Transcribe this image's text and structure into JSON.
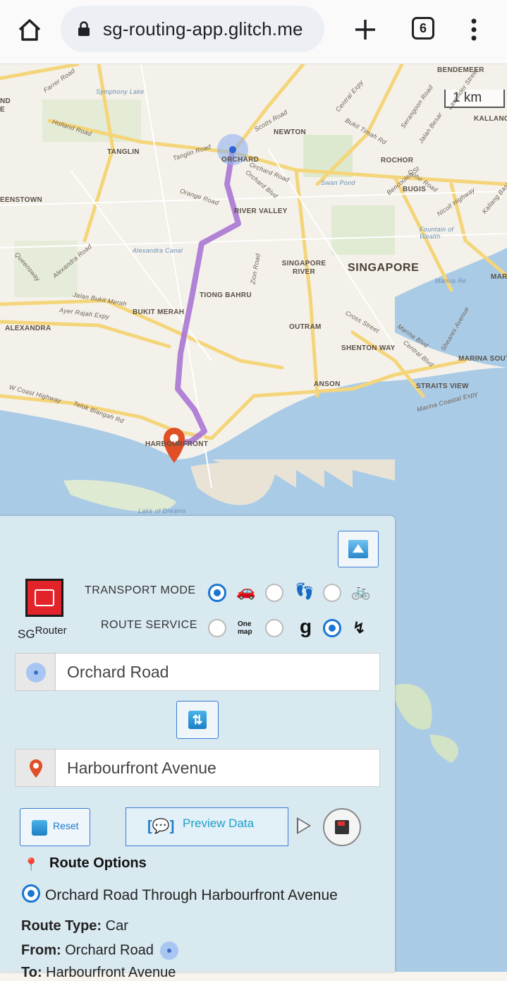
{
  "browser": {
    "url": "sg-routing-app.glitch.me",
    "tab_count": "6",
    "icons": [
      "home-icon",
      "lock-icon",
      "plus-icon",
      "tabs-icon",
      "more-vert-icon"
    ]
  },
  "map": {
    "scale_label": "1 km",
    "labels": {
      "bendemeer": "BENDEMEER",
      "kallang": "KALLANG",
      "newton": "NEWTON",
      "tanglin": "TANGLIN",
      "orchard": "ORCHARD",
      "rochor": "ROCHOR",
      "bugis": "BUGIS",
      "queenstown": "EENSTOWN",
      "river_valley": "RIVER VALLEY",
      "singapore_river": "SINGAPORE RIVER",
      "singapore": "SINGAPORE",
      "tiong_bahru": "TIONG BAHRU",
      "bukit_merah": "BUKIT MERAH",
      "alexandra": "ALEXANDRA",
      "outram": "OUTRAM",
      "shenton_way": "SHENTON WAY",
      "marina_south": "MARINA SOUT",
      "anson": "ANSON",
      "straits_view": "STRAITS VIEW",
      "harbourfront": "HARBOURFRONT",
      "mar": "MAR",
      "nd": "ND",
      "e": "E"
    },
    "road_labels": {
      "holland_road": "Holland Road",
      "farrer_road": "Farrer Road",
      "tanglin_road": "Tanglin Road",
      "orchard_road": "Orchard Road",
      "orchard_blvd": "Orchard Blvd",
      "scotts_road": "Scotts Road",
      "central_expy": "Central Expy",
      "bukit_timah": "Bukit Timah Rd",
      "serangoon": "Serangoon Road",
      "jalan_besar": "Jalan Besar",
      "orange_road": "Orange Road",
      "alexandra_road": "Alexandra Road",
      "queensway": "Queensway",
      "jalan_bukit_merah": "Jalan Bukit Merah",
      "ayer_rajah": "Ayer Rajah Expy",
      "zion_road": "Zion Road",
      "bencoolen": "Bencoolen St",
      "ophir": "Ophir Road",
      "nicoll": "Nicoll Highway",
      "cross_street": "Cross Street",
      "marina_blvd": "Marina Blvd",
      "central_blvd": "Central Blvd",
      "sheares": "Sheares Avenue",
      "marina_coastal": "Marina Coastal Expy",
      "w_coast": "W Coast Highway",
      "telok_blangah": "Telok Blangah Rd",
      "kallang_basin": "Kallang Basi",
      "lavender": "Lavender Street"
    },
    "water_labels": {
      "symphony": "Symphony Lake",
      "swan": "Swan Pond",
      "alexandra_canal": "Alexandra Canal",
      "fountain": "Fountain of Wealth",
      "marina_res": "Marina Re",
      "lake_dreams": "Lake of Dreams"
    }
  },
  "panel": {
    "logo_sg": "SG",
    "logo_router": "Router",
    "transport_mode_label": "TRANSPORT MODE",
    "route_service_label": "ROUTE SERVICE",
    "transport_modes": [
      {
        "name": "car",
        "icon": "🚗",
        "selected": true
      },
      {
        "name": "walk",
        "icon": "👣",
        "selected": false
      },
      {
        "name": "bicycle",
        "icon": "🚲",
        "selected": false
      }
    ],
    "route_services": [
      {
        "name": "onemap",
        "icon": "One map",
        "selected": false
      },
      {
        "name": "google",
        "icon": "g",
        "selected": false
      },
      {
        "name": "other",
        "icon": "↯",
        "selected": true
      }
    ],
    "from_value": "Orchard Road",
    "to_value": "Harbourfront Avenue",
    "reset_label": "Reset",
    "preview_icon": "[💬]",
    "preview_label": "Preview Data",
    "route_options_title": "Route Options",
    "route_option": "Orchard Road Through Harbourfront Avenue",
    "route_type_key": "Route Type:",
    "route_type_value": "Car",
    "from_key": "From:",
    "from_detail": "Orchard Road",
    "to_key": "To:",
    "to_detail": "Harbourfront Avenue"
  }
}
